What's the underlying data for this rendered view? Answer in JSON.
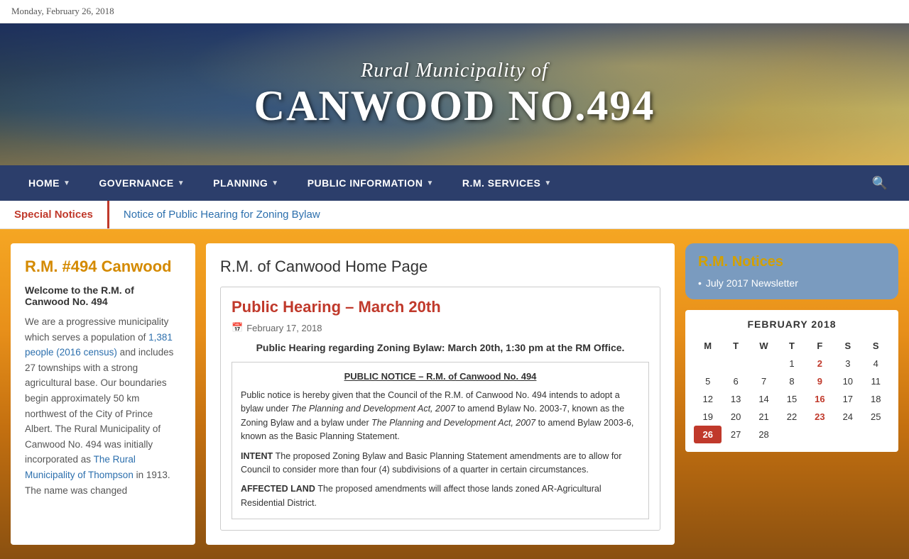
{
  "datebar": {
    "text": "Monday, February 26, 2018"
  },
  "header": {
    "subtitle": "Rural Municipality of",
    "title": "CANWOOD NO.494"
  },
  "nav": {
    "items": [
      {
        "label": "HOME",
        "id": "home"
      },
      {
        "label": "GOVERNANCE",
        "id": "governance"
      },
      {
        "label": "PLANNING",
        "id": "planning"
      },
      {
        "label": "PUBLIC INFORMATION",
        "id": "public-information"
      },
      {
        "label": "R.M. SERVICES",
        "id": "rm-services"
      }
    ]
  },
  "notices_bar": {
    "label": "Special Notices",
    "link": "Notice of Public Hearing for Zoning Bylaw"
  },
  "sidebar": {
    "title": "R.M. #494 Canwood",
    "welcome": "Welcome to the R.M. of Canwood No. 494",
    "text": "We are a progressive municipality which serves a population of 1,381 people (2016 census) and includes 27 townships with a strong agricultural base. Our boundaries begin approximately 50 km northwest of the City of Prince Albert. The Rural Municipality of Canwood No. 494 was initially incorporated as The Rural Municipality of Thompson in 1913. The name was changed"
  },
  "main": {
    "page_title": "R.M. of Canwood Home Page",
    "article": {
      "title": "Public Hearing – March 20th",
      "date": "February 17, 2018",
      "summary": "Public Hearing regarding Zoning Bylaw: March 20th, 1:30 pm at the RM Office.",
      "notice_title": "PUBLIC NOTICE – R.M. of Canwood No. 494",
      "notice_para1": "Public notice is hereby given that the Council of the R.M. of Canwood No. 494 intends to adopt a bylaw under The Planning and Development Act, 2007 to amend Bylaw No. 2003-7, known as the Zoning Bylaw and a bylaw under The Planning and Development Act, 2007 to amend Bylaw 2003-6, known as the Basic Planning Statement.",
      "notice_intent_label": "INTENT",
      "notice_intent": "The proposed Zoning Bylaw and Basic Planning Statement amendments are to allow for Council to consider more than four (4) subdivisions of a quarter in certain circumstances.",
      "notice_affected_label": "AFFECTED LAND",
      "notice_affected": "The proposed amendments will affect those lands zoned AR-Agricultural Residential District."
    }
  },
  "rm_notices": {
    "title": "R.M. Notices",
    "items": [
      {
        "label": "July 2017 Newsletter"
      }
    ]
  },
  "calendar": {
    "title": "FEBRUARY 2018",
    "headers": [
      "M",
      "T",
      "W",
      "T",
      "F",
      "S",
      "S"
    ],
    "rows": [
      [
        "",
        "",
        "",
        "1",
        "2",
        "3",
        "4"
      ],
      [
        "5",
        "6",
        "7",
        "8",
        "9",
        "10",
        "11"
      ],
      [
        "12",
        "13",
        "14",
        "15",
        "16",
        "17",
        "18"
      ],
      [
        "19",
        "20",
        "21",
        "22",
        "23",
        "24",
        "25"
      ],
      [
        "26",
        "27",
        "28",
        "",
        "",
        "",
        ""
      ]
    ],
    "today": "26",
    "fridays": [
      "2",
      "9",
      "16",
      "23"
    ]
  }
}
